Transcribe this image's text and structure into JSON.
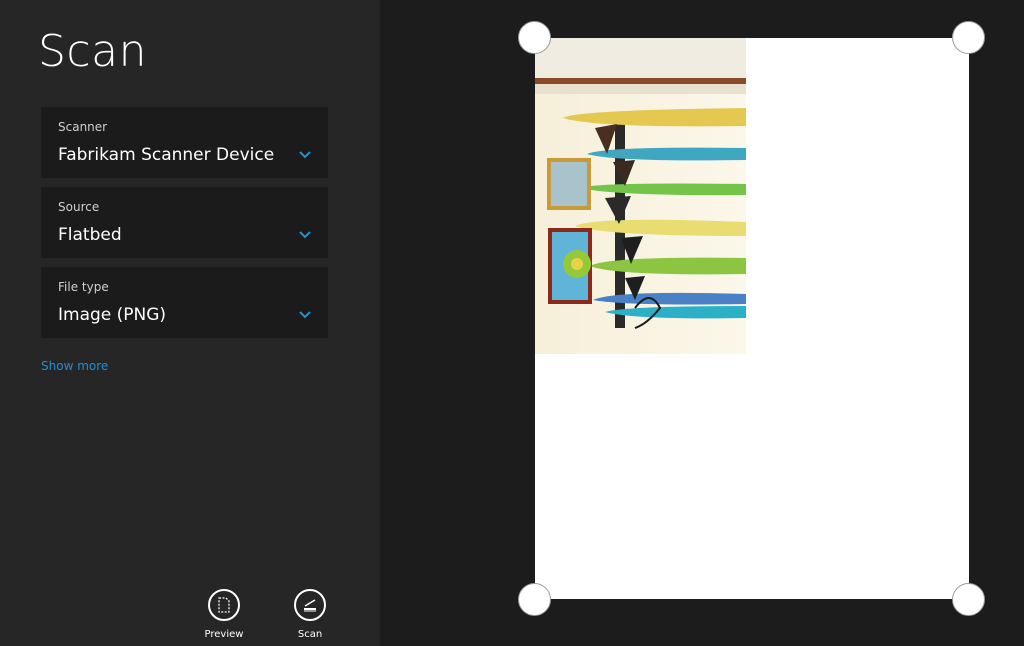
{
  "page": {
    "title": "Scan"
  },
  "settings": {
    "scanner": {
      "label": "Scanner",
      "value": "Fabrikam Scanner Device"
    },
    "source": {
      "label": "Source",
      "value": "Flatbed"
    },
    "file_type": {
      "label": "File type",
      "value": "Image (PNG)"
    },
    "show_more": "Show more"
  },
  "appbar": {
    "preview": {
      "label": "Preview",
      "icon": "preview-icon"
    },
    "scan": {
      "label": "Scan",
      "icon": "scan-icon"
    }
  },
  "colors": {
    "accent": "#1f8fd6",
    "pane_left": "#262626",
    "pane_right": "#1c1c1c",
    "field_bg": "#1b1b1b"
  }
}
